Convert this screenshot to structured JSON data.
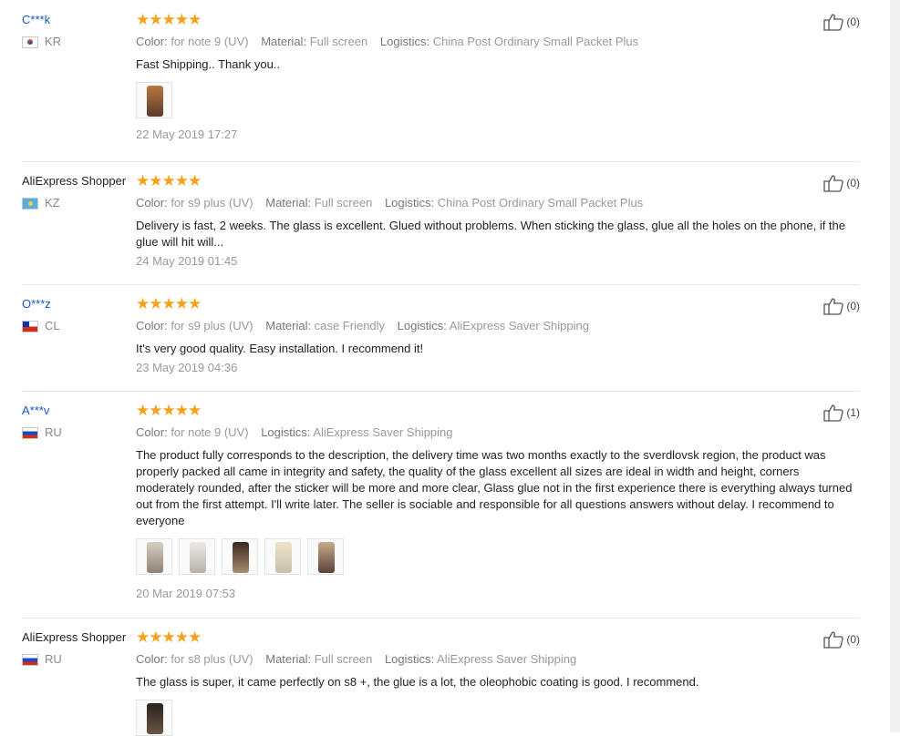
{
  "labels": {
    "color": "Color:",
    "material": "Material:",
    "logistics": "Logistics:"
  },
  "reviews": [
    {
      "user": "C***k",
      "country": "KR",
      "stars": 5,
      "color": "for note 9 (UV)",
      "material": "Full screen",
      "logistics": "China Post Ordinary Small Packet Plus",
      "text": "Fast Shipping.. Thank you..",
      "date": "22 May 2019 17:27",
      "likes": "(0)"
    },
    {
      "user": "AliExpress Shopper",
      "country": "KZ",
      "stars": 5,
      "color": "for s9 plus (UV)",
      "material": "Full screen",
      "logistics": "China Post Ordinary Small Packet Plus",
      "text": "Delivery is fast, 2 weeks. The glass is excellent. Glued without problems. When sticking the glass, glue all the holes on the phone, if the glue will hit will...",
      "date": "24 May 2019 01:45",
      "likes": "(0)"
    },
    {
      "user": "O***z",
      "country": "CL",
      "stars": 5,
      "color": "for s9 plus (UV)",
      "material": "case Friendly",
      "logistics": "AliExpress Saver Shipping",
      "text": "It's very good quality. Easy installation. I recommend it!",
      "date": "23 May 2019 04:36",
      "likes": "(0)"
    },
    {
      "user": "A***v",
      "country": "RU",
      "stars": 5,
      "color": "for note 9 (UV)",
      "logistics": "AliExpress Saver Shipping",
      "text": "The product fully corresponds to the description, the delivery time was two months exactly to the sverdlovsk region, the product was properly packed all came in integrity and safety, the quality of the glass excellent all sizes are ideal in width and height, corners moderately rounded, after the sticker will be more and more clear, Glass glue not in the first experience there is everything always turned out from the first attempt. I'll write later. The seller is sociable and responsible for all questions answers without delay. I recommend to everyone",
      "date": "20 Mar 2019 07:53",
      "likes": "(1)"
    },
    {
      "user": "AliExpress Shopper",
      "country": "RU",
      "stars": 5,
      "color": "for s8 plus (UV)",
      "material": "Full screen",
      "logistics": "AliExpress Saver Shipping",
      "text": "The glass is super, it came perfectly on s8 +, the glue is a lot, the oleophobic coating is good. I recommend.",
      "likes": "(0)"
    }
  ],
  "colors": {
    "star": "#f4a11b",
    "username_link": "#1a55c9",
    "muted": "#999999"
  },
  "icons": {
    "like": "thumbs-up-icon",
    "star": "star-icon"
  }
}
